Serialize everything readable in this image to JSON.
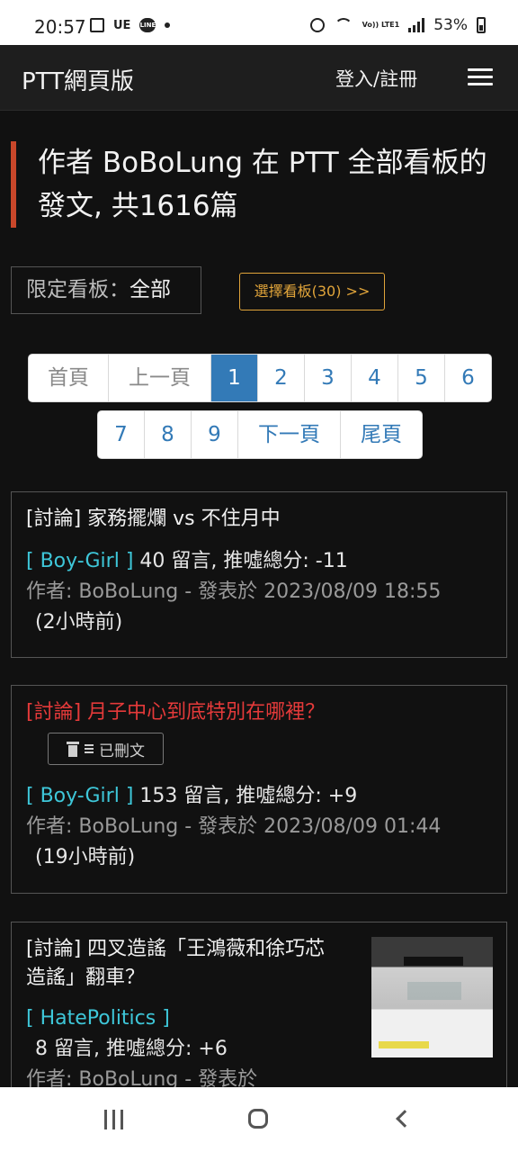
{
  "status_bar": {
    "time": "20:57",
    "carrier_badge": "UE",
    "line_badge": "LINE",
    "volte": "Vo)) LTE1",
    "battery": "53%"
  },
  "navbar": {
    "brand": "PTT網頁版",
    "login": "登入/註冊"
  },
  "title": "作者 BoBoLung 在 PTT 全部看板的發文, 共1616篇",
  "filter": {
    "label": "限定看板：",
    "value": "全部",
    "choose_button": "選擇看板(30) >>"
  },
  "pagination": {
    "row1": [
      "首頁",
      "上一頁",
      "1",
      "2",
      "3",
      "4",
      "5",
      "6"
    ],
    "row2": [
      "7",
      "8",
      "9",
      "下一頁",
      "尾頁"
    ],
    "active": "1"
  },
  "posts": [
    {
      "title": "[討論] 家務擺爛 vs 不住月中",
      "board": "[ Boy-Girl ]",
      "stats": "40 留言, 推噓總分: -11",
      "byline": "作者: BoBoLung - 發表於 2023/08/09 18:55",
      "ago": "(2小時前)"
    },
    {
      "title": "[討論] 月子中心到底特別在哪裡？",
      "deleted_label": "已刪文",
      "board": "[ Boy-Girl ]",
      "stats": "153 留言, 推噓總分: +9",
      "byline": "作者: BoBoLung - 發表於 2023/08/09 01:44",
      "ago": "(19小時前)"
    },
    {
      "title": "[討論] 四叉造謠「王鴻薇和徐巧芯造謠」翻車？",
      "board": "[ HatePolitics ]",
      "stats": "8 留言, 推噓總分: +6",
      "byline": "作者: BoBoLung - 發表於"
    }
  ],
  "colors": {
    "accent_red": "#c9472a",
    "board_cyan": "#3ec7d9",
    "choose_orange": "#e0a43a",
    "page_active": "#337ab7",
    "deleted_red": "#e53a3a"
  }
}
